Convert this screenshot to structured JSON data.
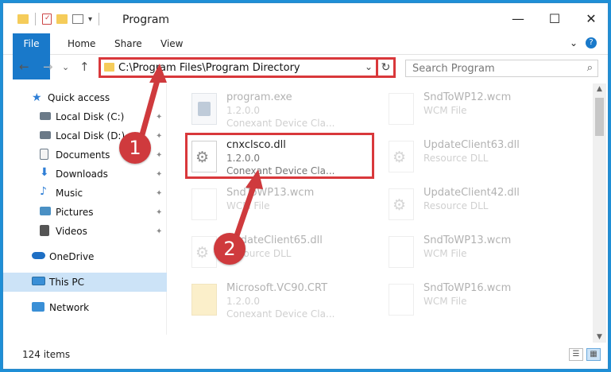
{
  "window": {
    "title": "Program",
    "minimize_glyph": "—",
    "maximize_glyph": "☐",
    "close_glyph": "✕"
  },
  "ribbon": {
    "tabs": [
      "File",
      "Home",
      "Share",
      "View"
    ],
    "expand_glyph": "⌄",
    "help_glyph": "?"
  },
  "nav": {
    "back_glyph": "←",
    "forward_glyph": "→",
    "recent_glyph": "⌄",
    "up_glyph": "↑",
    "address_path": "C:\\Program Files\\Program Directory",
    "address_dropdown_glyph": "⌄",
    "refresh_glyph": "↻",
    "search_placeholder": "Search Program",
    "search_glyph": "⌕"
  },
  "sidebar": {
    "items": [
      {
        "label": "Quick access",
        "icon": "star-icon",
        "color": "#2e7ed6",
        "pinned": false
      },
      {
        "label": "Local Disk (C:)",
        "icon": "drive-icon",
        "color": "#6b7a88",
        "pinned": true
      },
      {
        "label": "Local Disk (D:)",
        "icon": "drive-icon",
        "color": "#6b7a88",
        "pinned": true
      },
      {
        "label": "Documents",
        "icon": "documents-icon",
        "color": "#6b7a88",
        "pinned": true
      },
      {
        "label": "Downloads",
        "icon": "download-icon",
        "color": "#2e7ed6",
        "pinned": true
      },
      {
        "label": "Music",
        "icon": "music-icon",
        "color": "#2e7ed6",
        "pinned": true
      },
      {
        "label": "Pictures",
        "icon": "pictures-icon",
        "color": "#4a90c4",
        "pinned": true
      },
      {
        "label": "Videos",
        "icon": "videos-icon",
        "color": "#555555",
        "pinned": true
      },
      {
        "label": "OneDrive",
        "icon": "cloud-icon",
        "color": "#1e6fc4",
        "pinned": false
      },
      {
        "label": "This PC",
        "icon": "computer-icon",
        "color": "#3a8fd6",
        "pinned": false
      },
      {
        "label": "Network",
        "icon": "network-icon",
        "color": "#3a8fd6",
        "pinned": false
      }
    ],
    "pin_glyph": "📌"
  },
  "files": [
    {
      "name": "program.exe",
      "version": "1.2.0.0",
      "desc": "Conexant Device Cla...",
      "icon": "exe-icon",
      "column": 0,
      "row": 0,
      "faded": true
    },
    {
      "name": "cnxclsco.dll",
      "version": "1.2.0.0",
      "desc": "Conexant Device Cla...",
      "icon": "dll-icon",
      "column": 0,
      "row": 1,
      "faded": false,
      "highlighted": true
    },
    {
      "name": "SndToWP13.wcm",
      "version": "",
      "desc": "WCM File",
      "icon": "file-icon",
      "column": 0,
      "row": 2,
      "faded": true
    },
    {
      "name": "UpdateClient65.dll",
      "version": "",
      "desc": "Resource DLL",
      "icon": "dll-icon",
      "column": 0,
      "row": 3,
      "faded": true
    },
    {
      "name": "Microsoft.VC90.CRT",
      "version": "1.2.0.0",
      "desc": "Conexant Device Cla...",
      "icon": "folder-icon",
      "column": 0,
      "row": 4,
      "faded": true
    },
    {
      "name": "SndToWP12.wcm",
      "version": "",
      "desc": "WCM File",
      "icon": "file-icon",
      "column": 1,
      "row": 0,
      "faded": true
    },
    {
      "name": "UpdateClient63.dll",
      "version": "",
      "desc": "Resource DLL",
      "icon": "dll-icon",
      "column": 1,
      "row": 1,
      "faded": true
    },
    {
      "name": "UpdateClient42.dll",
      "version": "",
      "desc": "Resource DLL",
      "icon": "dll-icon",
      "column": 1,
      "row": 2,
      "faded": true
    },
    {
      "name": "SndToWP13.wcm",
      "version": "",
      "desc": "WCM File",
      "icon": "file-icon",
      "column": 1,
      "row": 3,
      "faded": true
    },
    {
      "name": "SndToWP16.wcm",
      "version": "",
      "desc": "WCM File",
      "icon": "file-icon",
      "column": 1,
      "row": 4,
      "faded": true
    }
  ],
  "status": {
    "item_count": "124 items"
  },
  "callouts": [
    {
      "number": "1",
      "color": "#cf3a3d"
    },
    {
      "number": "2",
      "color": "#cf3a3d"
    }
  ]
}
